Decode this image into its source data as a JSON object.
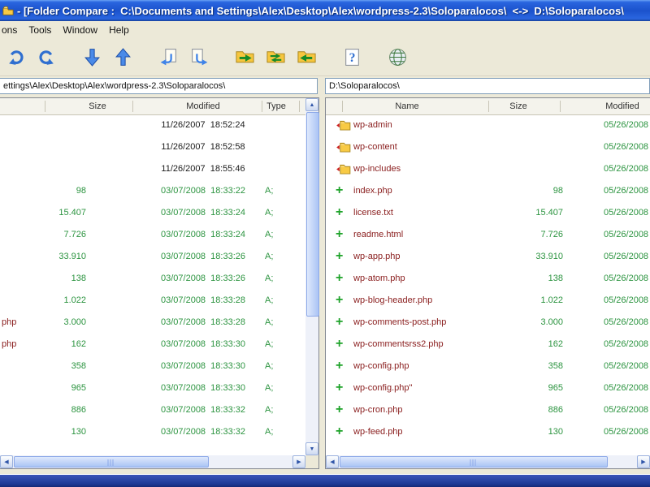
{
  "window": {
    "title": "- [Folder Compare :  C:\\Documents and Settings\\Alex\\Desktop\\Alex\\wordpress-2.3\\Soloparalocos\\  <->  D:\\Soloparalocos\\"
  },
  "menu": {
    "items": [
      "ons",
      "Tools",
      "Window",
      "Help"
    ]
  },
  "toolbar": {
    "buttons": [
      {
        "name": "undo-button",
        "icon": "curl_left",
        "gap": false
      },
      {
        "name": "redo-button",
        "icon": "curl_right",
        "gap": false
      },
      {
        "name": "next-difference-button",
        "icon": "down",
        "gap": true
      },
      {
        "name": "previous-difference-button",
        "icon": "up",
        "gap": false
      },
      {
        "name": "copy-file-left-button",
        "icon": "doc_arrow_left",
        "gap": true
      },
      {
        "name": "copy-file-right-button",
        "icon": "doc_arrow_right",
        "gap": false
      },
      {
        "name": "copy-folder-right-button",
        "icon": "folders_right",
        "gap": true
      },
      {
        "name": "sync-folders-button",
        "icon": "folders_sync",
        "gap": false
      },
      {
        "name": "copy-folder-left-button",
        "icon": "folders_left",
        "gap": false
      },
      {
        "name": "help-button",
        "icon": "help",
        "gap": true
      },
      {
        "name": "web-update-button",
        "icon": "globe",
        "gap": true
      }
    ]
  },
  "left_pane": {
    "path": "ettings\\Alex\\Desktop\\Alex\\wordpress-2.3\\Soloparalocos\\",
    "columns": [
      "Size",
      "Modified",
      "Type"
    ],
    "rows": [
      {
        "kind": "folder",
        "name_fragment": "",
        "size": "",
        "modified": "11/26/2007  18:52:24",
        "type": ""
      },
      {
        "kind": "folder",
        "name_fragment": "",
        "size": "",
        "modified": "11/26/2007  18:52:58",
        "type": ""
      },
      {
        "kind": "folder",
        "name_fragment": "",
        "size": "",
        "modified": "11/26/2007  18:55:46",
        "type": ""
      },
      {
        "kind": "file",
        "name_fragment": "",
        "size": "98",
        "modified": "03/07/2008  18:33:22",
        "type": "A;"
      },
      {
        "kind": "file",
        "name_fragment": "",
        "size": "15.407",
        "modified": "03/07/2008  18:33:24",
        "type": "A;"
      },
      {
        "kind": "file",
        "name_fragment": "",
        "size": "7.726",
        "modified": "03/07/2008  18:33:24",
        "type": "A;"
      },
      {
        "kind": "file",
        "name_fragment": "",
        "size": "33.910",
        "modified": "03/07/2008  18:33:26",
        "type": "A;"
      },
      {
        "kind": "file",
        "name_fragment": "",
        "size": "138",
        "modified": "03/07/2008  18:33:26",
        "type": "A;"
      },
      {
        "kind": "file",
        "name_fragment": "",
        "size": "1.022",
        "modified": "03/07/2008  18:33:28",
        "type": "A;"
      },
      {
        "kind": "file",
        "name_fragment": "php",
        "size": "3.000",
        "modified": "03/07/2008  18:33:28",
        "type": "A;"
      },
      {
        "kind": "file",
        "name_fragment": "php",
        "size": "162",
        "modified": "03/07/2008  18:33:30",
        "type": "A;"
      },
      {
        "kind": "file",
        "name_fragment": "",
        "size": "358",
        "modified": "03/07/2008  18:33:30",
        "type": "A;"
      },
      {
        "kind": "file",
        "name_fragment": "",
        "size": "965",
        "modified": "03/07/2008  18:33:30",
        "type": "A;"
      },
      {
        "kind": "file",
        "name_fragment": "",
        "size": "886",
        "modified": "03/07/2008  18:33:32",
        "type": "A;"
      },
      {
        "kind": "file",
        "name_fragment": "",
        "size": "130",
        "modified": "03/07/2008  18:33:32",
        "type": "A;"
      }
    ]
  },
  "right_pane": {
    "path": "D:\\Soloparalocos\\",
    "columns": [
      "Name",
      "Size",
      "Modified"
    ],
    "rows": [
      {
        "kind": "folder",
        "name": "wp-admin",
        "size": "",
        "modified": "05/26/2008"
      },
      {
        "kind": "folder",
        "name": "wp-content",
        "size": "",
        "modified": "05/26/2008"
      },
      {
        "kind": "folder",
        "name": "wp-includes",
        "size": "",
        "modified": "05/26/2008"
      },
      {
        "kind": "file",
        "name": "index.php",
        "size": "98",
        "modified": "05/26/2008"
      },
      {
        "kind": "file",
        "name": "license.txt",
        "size": "15.407",
        "modified": "05/26/2008"
      },
      {
        "kind": "file",
        "name": "readme.html",
        "size": "7.726",
        "modified": "05/26/2008"
      },
      {
        "kind": "file",
        "name": "wp-app.php",
        "size": "33.910",
        "modified": "05/26/2008"
      },
      {
        "kind": "file",
        "name": "wp-atom.php",
        "size": "138",
        "modified": "05/26/2008"
      },
      {
        "kind": "file",
        "name": "wp-blog-header.php",
        "size": "1.022",
        "modified": "05/26/2008"
      },
      {
        "kind": "file",
        "name": "wp-comments-post.php",
        "size": "3.000",
        "modified": "05/26/2008"
      },
      {
        "kind": "file",
        "name": "wp-commentsrss2.php",
        "size": "162",
        "modified": "05/26/2008"
      },
      {
        "kind": "file",
        "name": "wp-config.php",
        "size": "358",
        "modified": "05/26/2008"
      },
      {
        "kind": "file",
        "name": "wp-config.php\"",
        "size": "965",
        "modified": "05/26/2008"
      },
      {
        "kind": "file",
        "name": "wp-cron.php",
        "size": "886",
        "modified": "05/26/2008"
      },
      {
        "kind": "file",
        "name": "wp-feed.php",
        "size": "130",
        "modified": "05/26/2008"
      }
    ]
  },
  "colors": {
    "title_blue": "#1b52cc",
    "file_green": "#2c9440",
    "name_maroon": "#8b2020",
    "folder_yellow": "#f8ca44",
    "status_navy": "#1e3a96"
  }
}
